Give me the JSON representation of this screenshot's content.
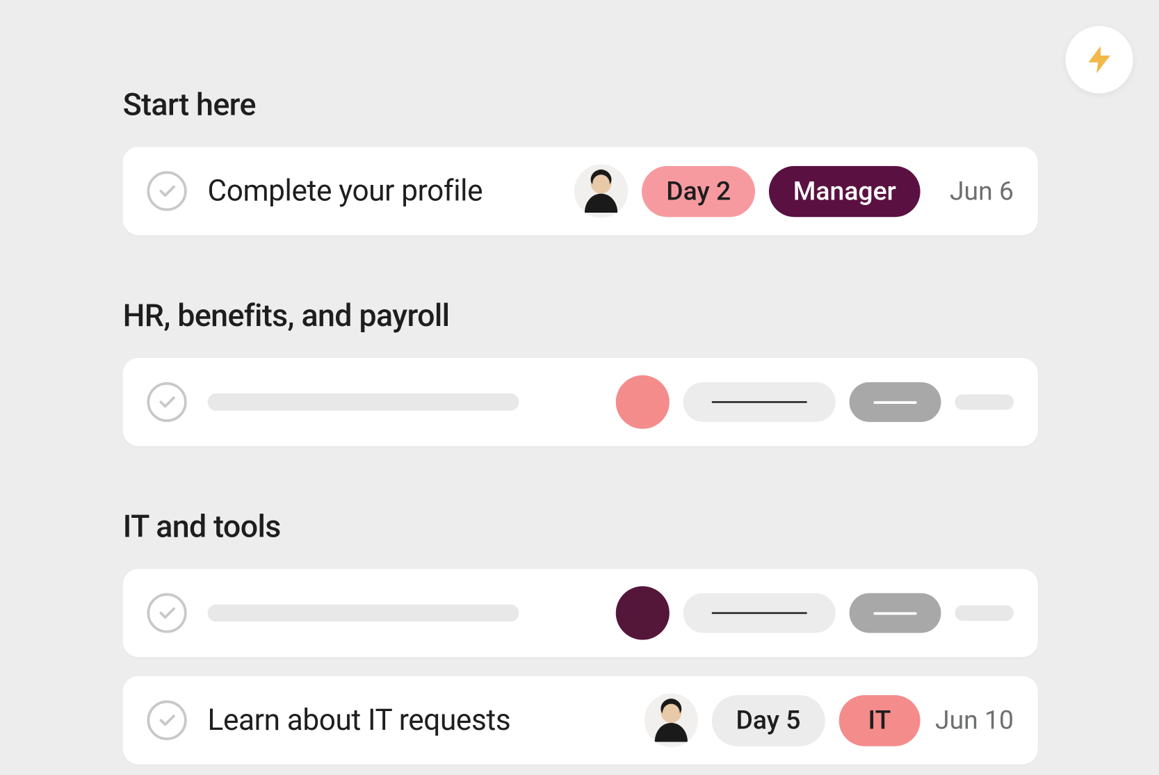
{
  "sections": [
    {
      "title": "Start here",
      "tasks": [
        {
          "type": "full",
          "title": "Complete your profile",
          "day_pill": {
            "label": "Day 2",
            "style": "pink"
          },
          "role_pill": {
            "label": "Manager",
            "style": "maroon"
          },
          "due": "Jun 6"
        }
      ]
    },
    {
      "title": "HR, benefits, and payroll",
      "tasks": [
        {
          "type": "placeholder",
          "dot_color": "pink"
        }
      ]
    },
    {
      "title": "IT and tools",
      "tasks": [
        {
          "type": "placeholder",
          "dot_color": "maroon"
        },
        {
          "type": "full",
          "title": "Learn about IT requests",
          "day_pill": {
            "label": "Day 5",
            "style": "gray"
          },
          "role_pill": {
            "label": "IT",
            "style": "coral"
          },
          "due": "Jun 10"
        }
      ]
    }
  ],
  "colors": {
    "pink": "#f79aa0",
    "coral": "#f48c8c",
    "maroon": "#5a1141",
    "gray_pill": "#ececec",
    "text": "#1e1e1e",
    "muted": "#6d6e6f"
  }
}
